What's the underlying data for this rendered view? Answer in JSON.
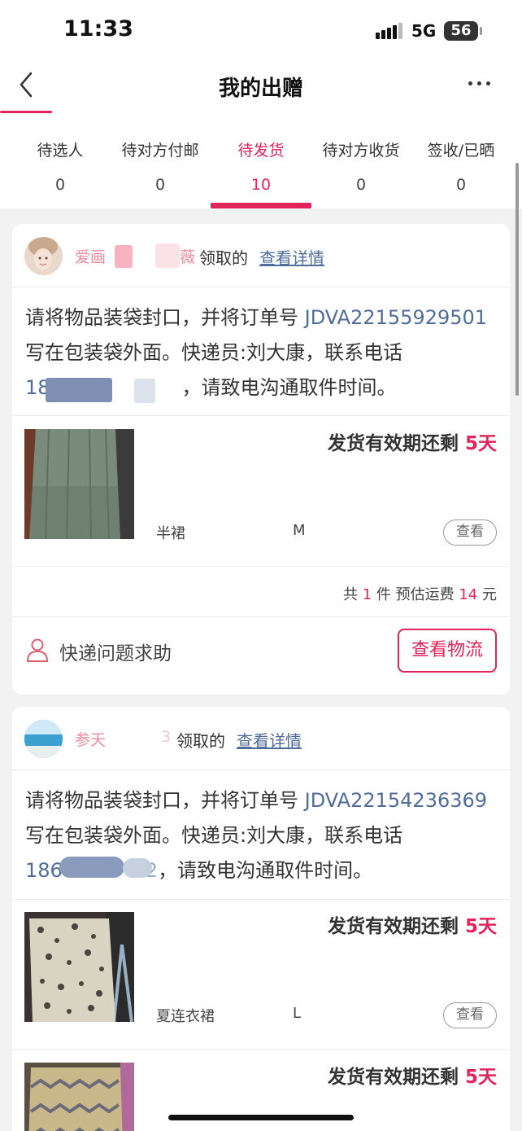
{
  "status_bar": {
    "time": "11:33",
    "network": "5G",
    "battery": "56"
  },
  "nav": {
    "title": "我的出赠"
  },
  "tabs": [
    {
      "label": "待选人",
      "count": "0"
    },
    {
      "label": "待对方付邮",
      "count": "0"
    },
    {
      "label": "待发货",
      "count": "10",
      "active": true
    },
    {
      "label": "待对方收货",
      "count": "0"
    },
    {
      "label": "签收/已晒",
      "count": "0"
    }
  ],
  "orders": [
    {
      "receiver_visible": "爱画",
      "receiver_tail": "薇",
      "claim_text": "领取的",
      "detail_link": "查看详情",
      "instr_part1": "请将物品装袋封口，并将订单号 ",
      "order_no": "JDVA22155929501",
      "instr_part2": " 写在包装袋外面。快递员:刘大康，联系电话",
      "phone_visible": "18",
      "instr_part3": "，请致电沟通取件时间。",
      "items": [
        {
          "deadline_label": "发货有效期还剩",
          "deadline_days": "5天",
          "name": "半裙",
          "size": "M",
          "view_label": "查看"
        }
      ],
      "summary": {
        "prefix": "共",
        "count": "1",
        "mid": "件 预估运费",
        "fee": "14",
        "suffix": "元"
      },
      "help_label": "快递问题求助",
      "logistics_label": "查看物流"
    },
    {
      "receiver_visible": "参天",
      "receiver_tail": "3",
      "claim_text": "领取的",
      "detail_link": "查看详情",
      "instr_part1": "请将物品装袋封口，并将订单号 ",
      "order_no": "JDVA22154236369",
      "instr_part2": " 写在包装袋外面。快递员:刘大康，联系电话",
      "phone_visible": "186",
      "phone_tail": "2",
      "instr_part3": "，请致电沟通取件时间。",
      "items": [
        {
          "deadline_label": "发货有效期还剩",
          "deadline_days": "5天",
          "name": "夏连衣裙",
          "size": "L",
          "view_label": "查看"
        },
        {
          "deadline_label": "发货有效期还剩",
          "deadline_days": "5天"
        }
      ]
    }
  ],
  "colors": {
    "accent": "#e3245a",
    "link": "#4f6c9a",
    "receiver": "#f08a9c"
  }
}
